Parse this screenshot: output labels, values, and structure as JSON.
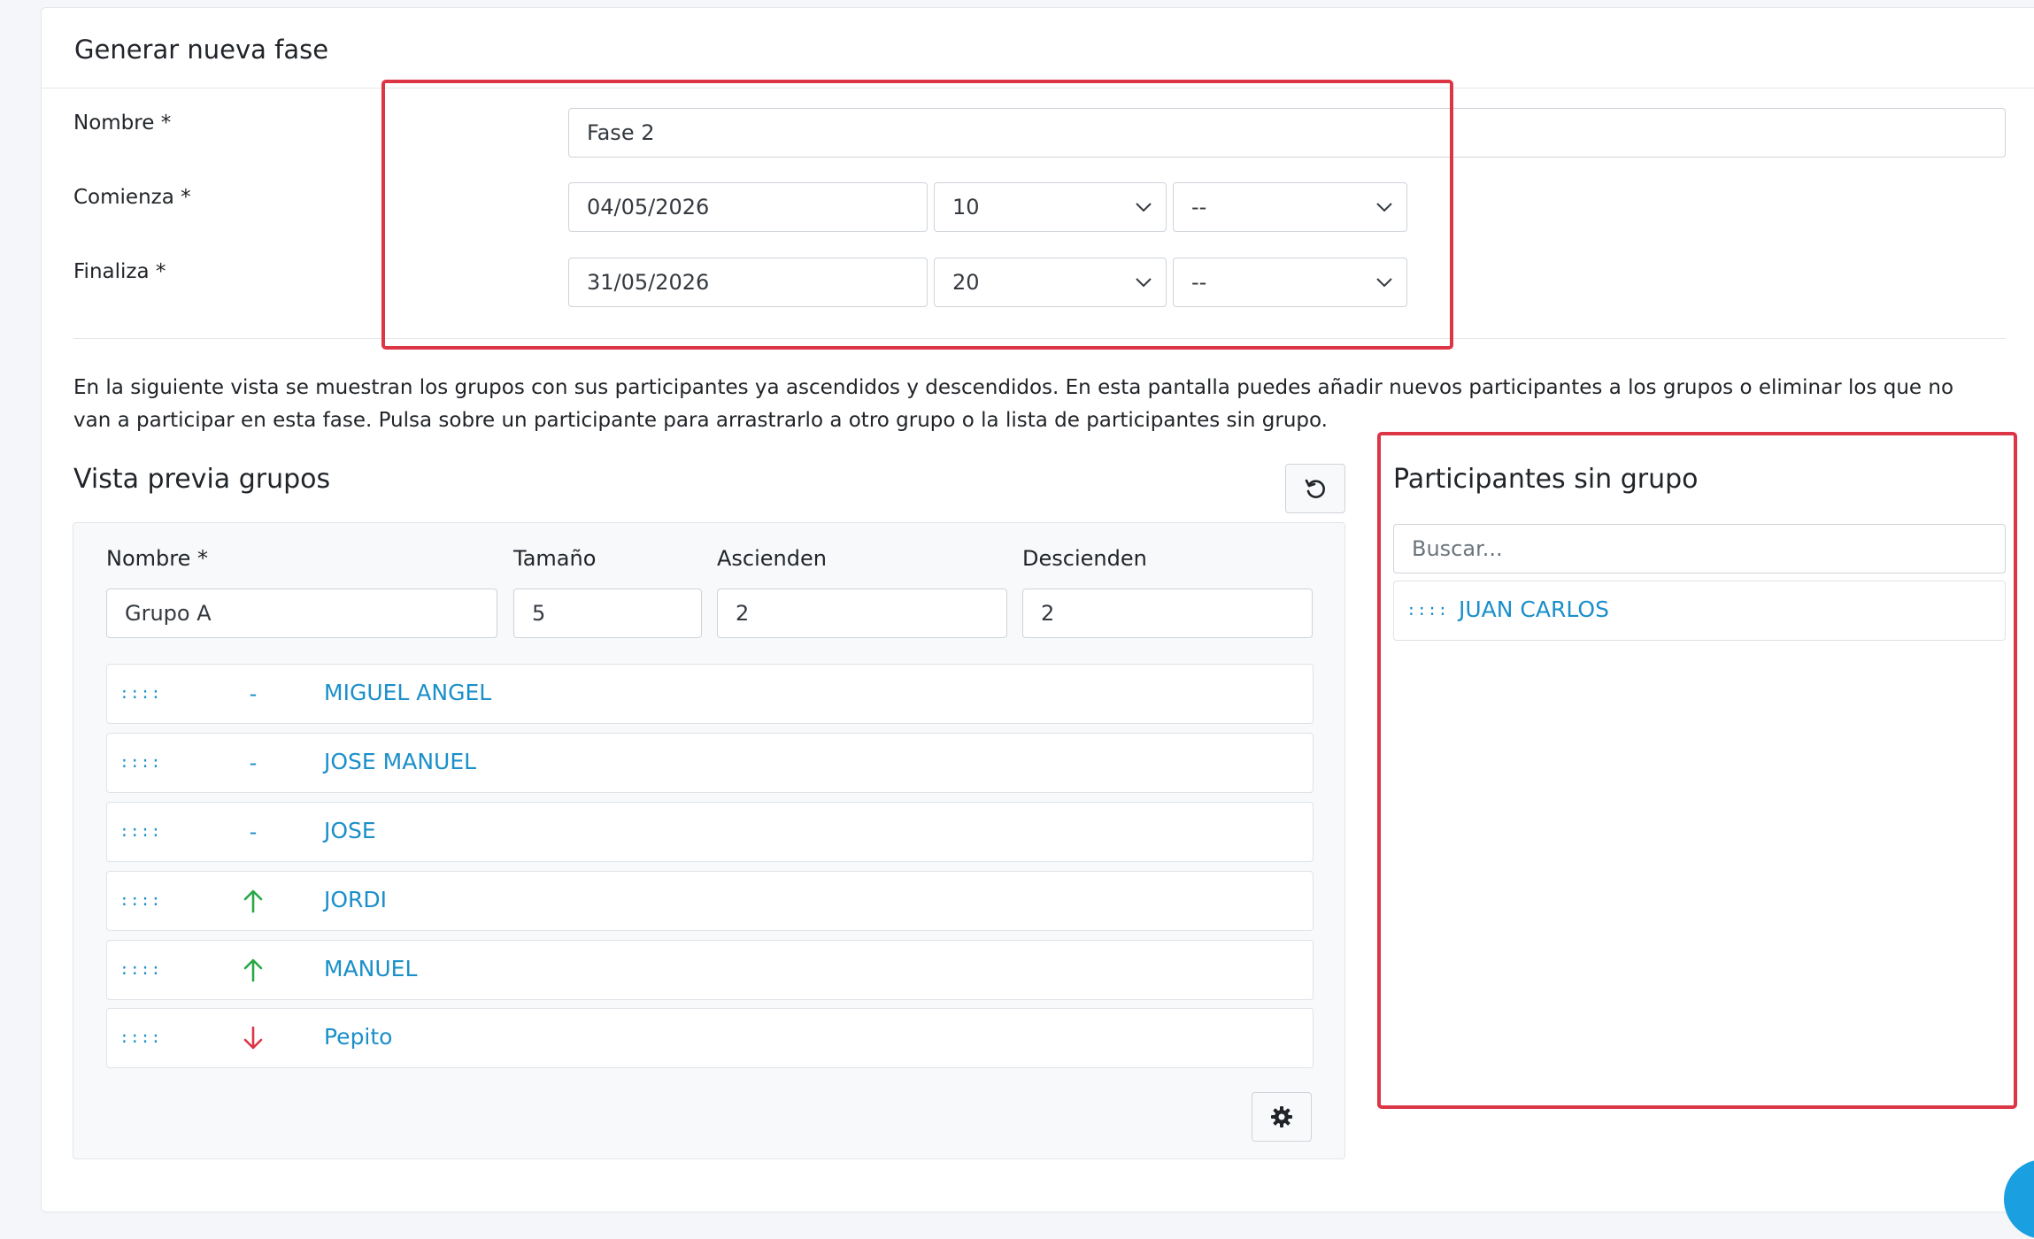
{
  "card": {
    "title": "Generar nueva fase"
  },
  "form": {
    "nombre": {
      "label": "Nombre *",
      "value": "Fase 2"
    },
    "comienza": {
      "label": "Comienza *",
      "date": "04/05/2026",
      "hour": "10",
      "minute": "--"
    },
    "finaliza": {
      "label": "Finaliza *",
      "date": "31/05/2026",
      "hour": "20",
      "minute": "--"
    }
  },
  "description": "En la siguiente vista se muestran los grupos con sus participantes ya ascendidos y descendidos. En esta pantalla puedes añadir nuevos participantes a los grupos o eliminar los que no van a participar en esta fase. Pulsa sobre un participante para arrastrarlo a otro grupo o la lista de participantes sin grupo.",
  "preview": {
    "title": "Vista previa grupos",
    "group": {
      "labels": {
        "nombre": "Nombre *",
        "tamano": "Tamaño",
        "ascienden": "Ascienden",
        "descienden": "Descienden"
      },
      "values": {
        "nombre": "Grupo A",
        "tamano": "5",
        "ascienden": "2",
        "descienden": "2"
      },
      "members": [
        {
          "handle": "::::",
          "status": "none",
          "status_text": "-",
          "name": "MIGUEL ANGEL"
        },
        {
          "handle": "::::",
          "status": "none",
          "status_text": "-",
          "name": "JOSE MANUEL"
        },
        {
          "handle": "::::",
          "status": "none",
          "status_text": "-",
          "name": "JOSE"
        },
        {
          "handle": "::::",
          "status": "up",
          "status_text": "",
          "name": "JORDI"
        },
        {
          "handle": "::::",
          "status": "up",
          "status_text": "",
          "name": "MANUEL"
        },
        {
          "handle": "::::",
          "status": "down",
          "status_text": "",
          "name": "Pepito"
        }
      ]
    }
  },
  "unassigned": {
    "title": "Participantes sin grupo",
    "search_placeholder": "Buscar...",
    "members": [
      {
        "handle": "::::",
        "name": "JUAN CARLOS"
      }
    ]
  },
  "colors": {
    "link": "#1a8fc9",
    "up": "#28a745",
    "down": "#dc3545",
    "highlight": "#dc3545"
  }
}
